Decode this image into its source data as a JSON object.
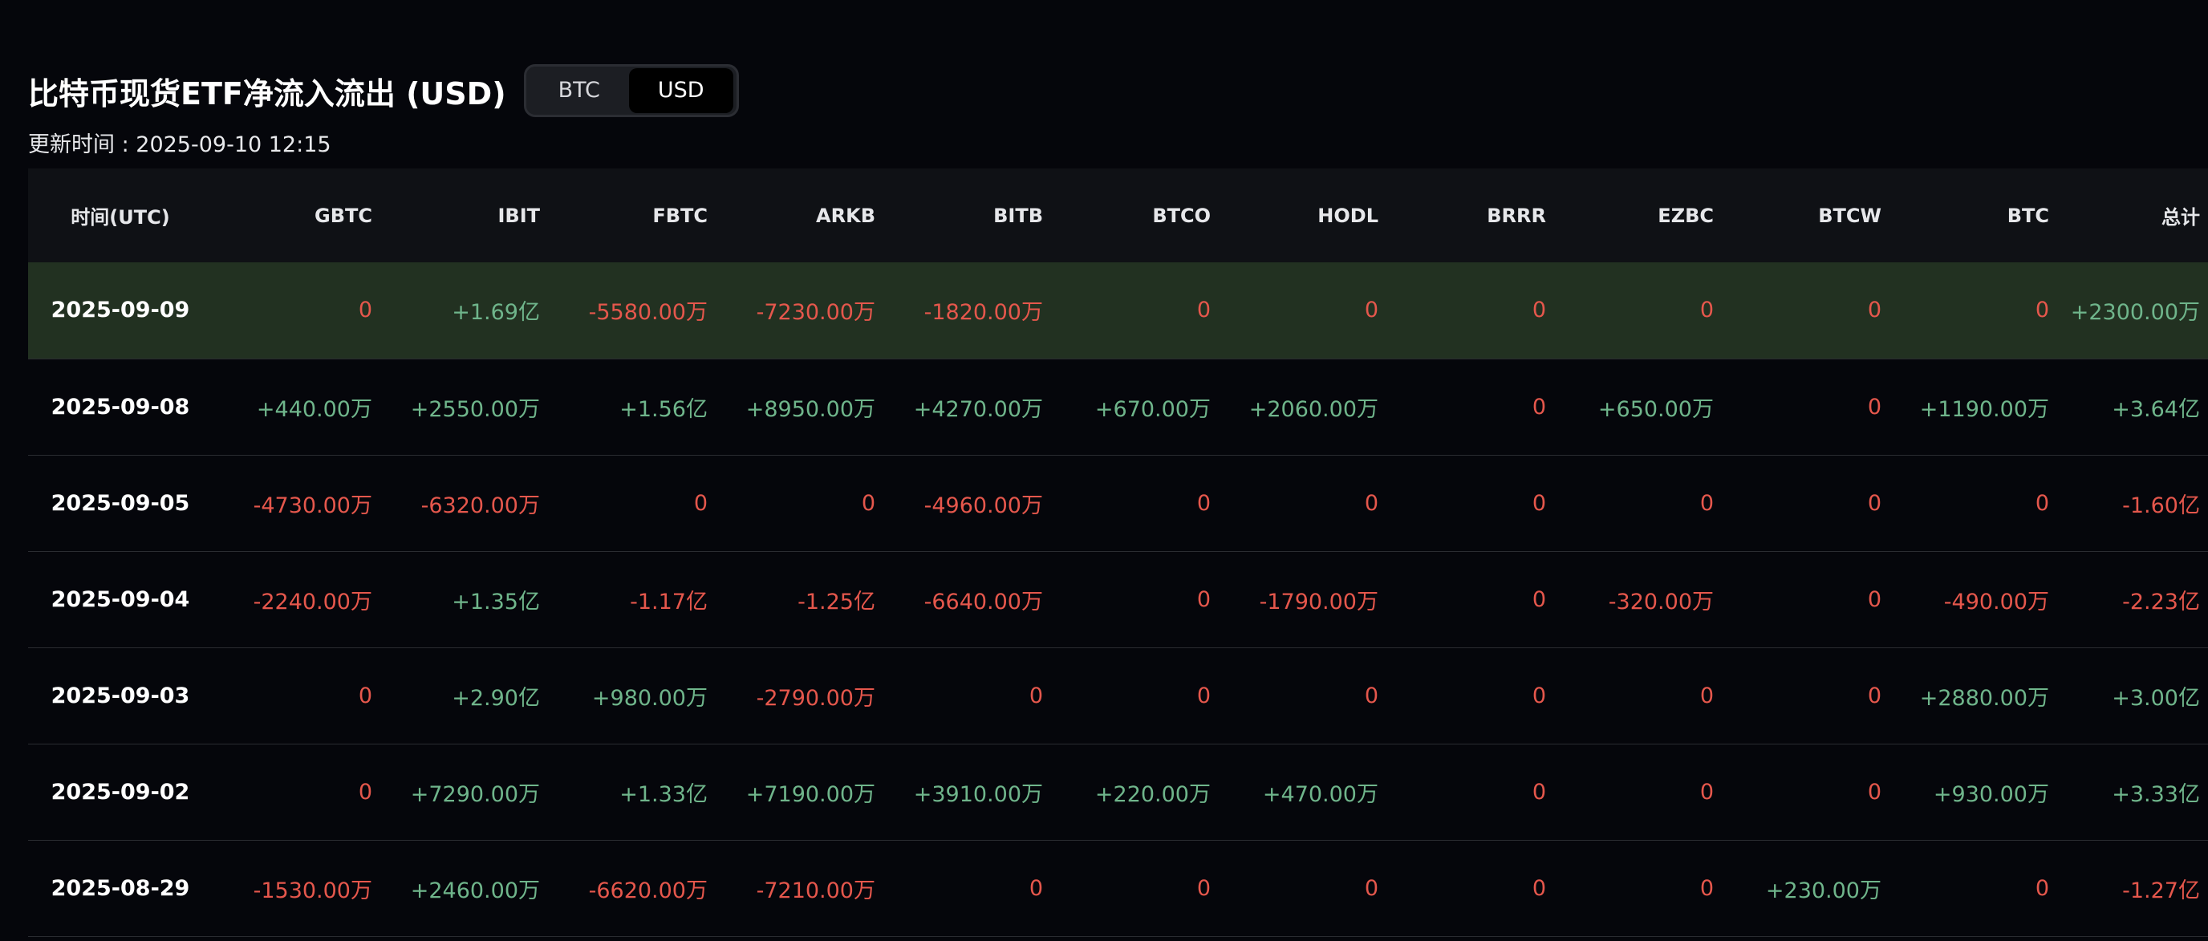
{
  "header": {
    "title": "比特币现货ETF净流入流出 (USD)",
    "toggle": {
      "options": [
        "BTC",
        "USD"
      ],
      "selected": "USD"
    },
    "update_time": "更新时间 : 2025-09-10 12:15"
  },
  "table": {
    "columns": [
      "时间(UTC)",
      "GBTC",
      "IBIT",
      "FBTC",
      "ARKB",
      "BITB",
      "BTCO",
      "HODL",
      "BRRR",
      "EZBC",
      "BTCW",
      "BTC",
      "总计"
    ],
    "rows": [
      {
        "date": "2025-09-09",
        "highlight": true,
        "values": [
          "0",
          "+1.69亿",
          "-5580.00万",
          "-7230.00万",
          "-1820.00万",
          "0",
          "0",
          "0",
          "0",
          "0",
          "0",
          "+2300.00万"
        ]
      },
      {
        "date": "2025-09-08",
        "highlight": false,
        "values": [
          "+440.00万",
          "+2550.00万",
          "+1.56亿",
          "+8950.00万",
          "+4270.00万",
          "+670.00万",
          "+2060.00万",
          "0",
          "+650.00万",
          "0",
          "+1190.00万",
          "+3.64亿"
        ]
      },
      {
        "date": "2025-09-05",
        "highlight": false,
        "values": [
          "-4730.00万",
          "-6320.00万",
          "0",
          "0",
          "-4960.00万",
          "0",
          "0",
          "0",
          "0",
          "0",
          "0",
          "-1.60亿"
        ]
      },
      {
        "date": "2025-09-04",
        "highlight": false,
        "values": [
          "-2240.00万",
          "+1.35亿",
          "-1.17亿",
          "-1.25亿",
          "-6640.00万",
          "0",
          "-1790.00万",
          "0",
          "-320.00万",
          "0",
          "-490.00万",
          "-2.23亿"
        ]
      },
      {
        "date": "2025-09-03",
        "highlight": false,
        "values": [
          "0",
          "+2.90亿",
          "+980.00万",
          "-2790.00万",
          "0",
          "0",
          "0",
          "0",
          "0",
          "0",
          "+2880.00万",
          "+3.00亿"
        ]
      },
      {
        "date": "2025-09-02",
        "highlight": false,
        "values": [
          "0",
          "+7290.00万",
          "+1.33亿",
          "+7190.00万",
          "+3910.00万",
          "+220.00万",
          "+470.00万",
          "0",
          "0",
          "0",
          "+930.00万",
          "+3.33亿"
        ]
      },
      {
        "date": "2025-08-29",
        "highlight": false,
        "values": [
          "-1530.00万",
          "+2460.00万",
          "-6620.00万",
          "-7210.00万",
          "0",
          "0",
          "0",
          "0",
          "0",
          "+230.00万",
          "0",
          "-1.27亿"
        ]
      }
    ]
  },
  "colors": {
    "background": "#05060b",
    "positive": "#6fb58b",
    "negative": "#e5574c",
    "highlight_row": "#223121",
    "header_row": "#0f1115"
  }
}
